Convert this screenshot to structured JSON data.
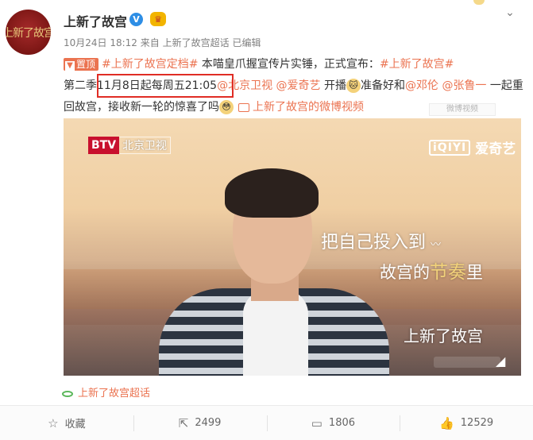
{
  "header": {
    "avatar_text": "上新了故宫",
    "user_name": "上新了故宫",
    "verified_glyph": "V",
    "badge_glyph": "♛",
    "date": "10月24日 18:12",
    "source_prefix": "来自",
    "source_name": "上新了故宫超话",
    "edited": "已编辑"
  },
  "post": {
    "pin_label": "置顶",
    "hashtag1": "#上新了故宫定档#",
    "text1": " 本喵皇爪握宣传片实锤，正式宣布：",
    "hashtag2": "#上新了故宫#",
    "text2": "第二季",
    "schedule": "11月8日起每周五21:05",
    "mention1": "@北京卫视",
    "mention2": "@爱奇艺",
    "text3": " 开播",
    "text4": "准备好和",
    "mention3": "@邓伦",
    "mention4": "@张鲁一",
    "text5": " 一起重回故宫，接收新一轮的惊喜了吗",
    "video_link": "上新了故宫的微博视频",
    "corner_watermark": "微博视频"
  },
  "video": {
    "btv_label": "BTV",
    "channel_label": "北京卫视",
    "iqiyi_box": "iQIYI",
    "iqiyi_label": "爱奇艺",
    "subtitle_line1": "把自己投入到",
    "subtitle_sign": "〰",
    "subtitle_line2_a": "故宫的",
    "subtitle_line2_b": "节奏",
    "subtitle_line2_c": "里",
    "show_logo": "上新了故宫",
    "mute_glyph": "🔇"
  },
  "topic_link": "上新了故宫超话",
  "actions": {
    "favorite_label": "收藏",
    "repost_count": "2499",
    "comment_count": "1806",
    "like_count": "12529"
  },
  "icons": {
    "chevron": "chevron-down-icon",
    "favorite": "star-icon",
    "repost": "share-icon",
    "comment": "comment-icon",
    "like": "thumbs-up-icon"
  },
  "colors": {
    "link": "#eb7350",
    "mention": "#2e8ee5",
    "highlight_box": "#e02d25"
  }
}
